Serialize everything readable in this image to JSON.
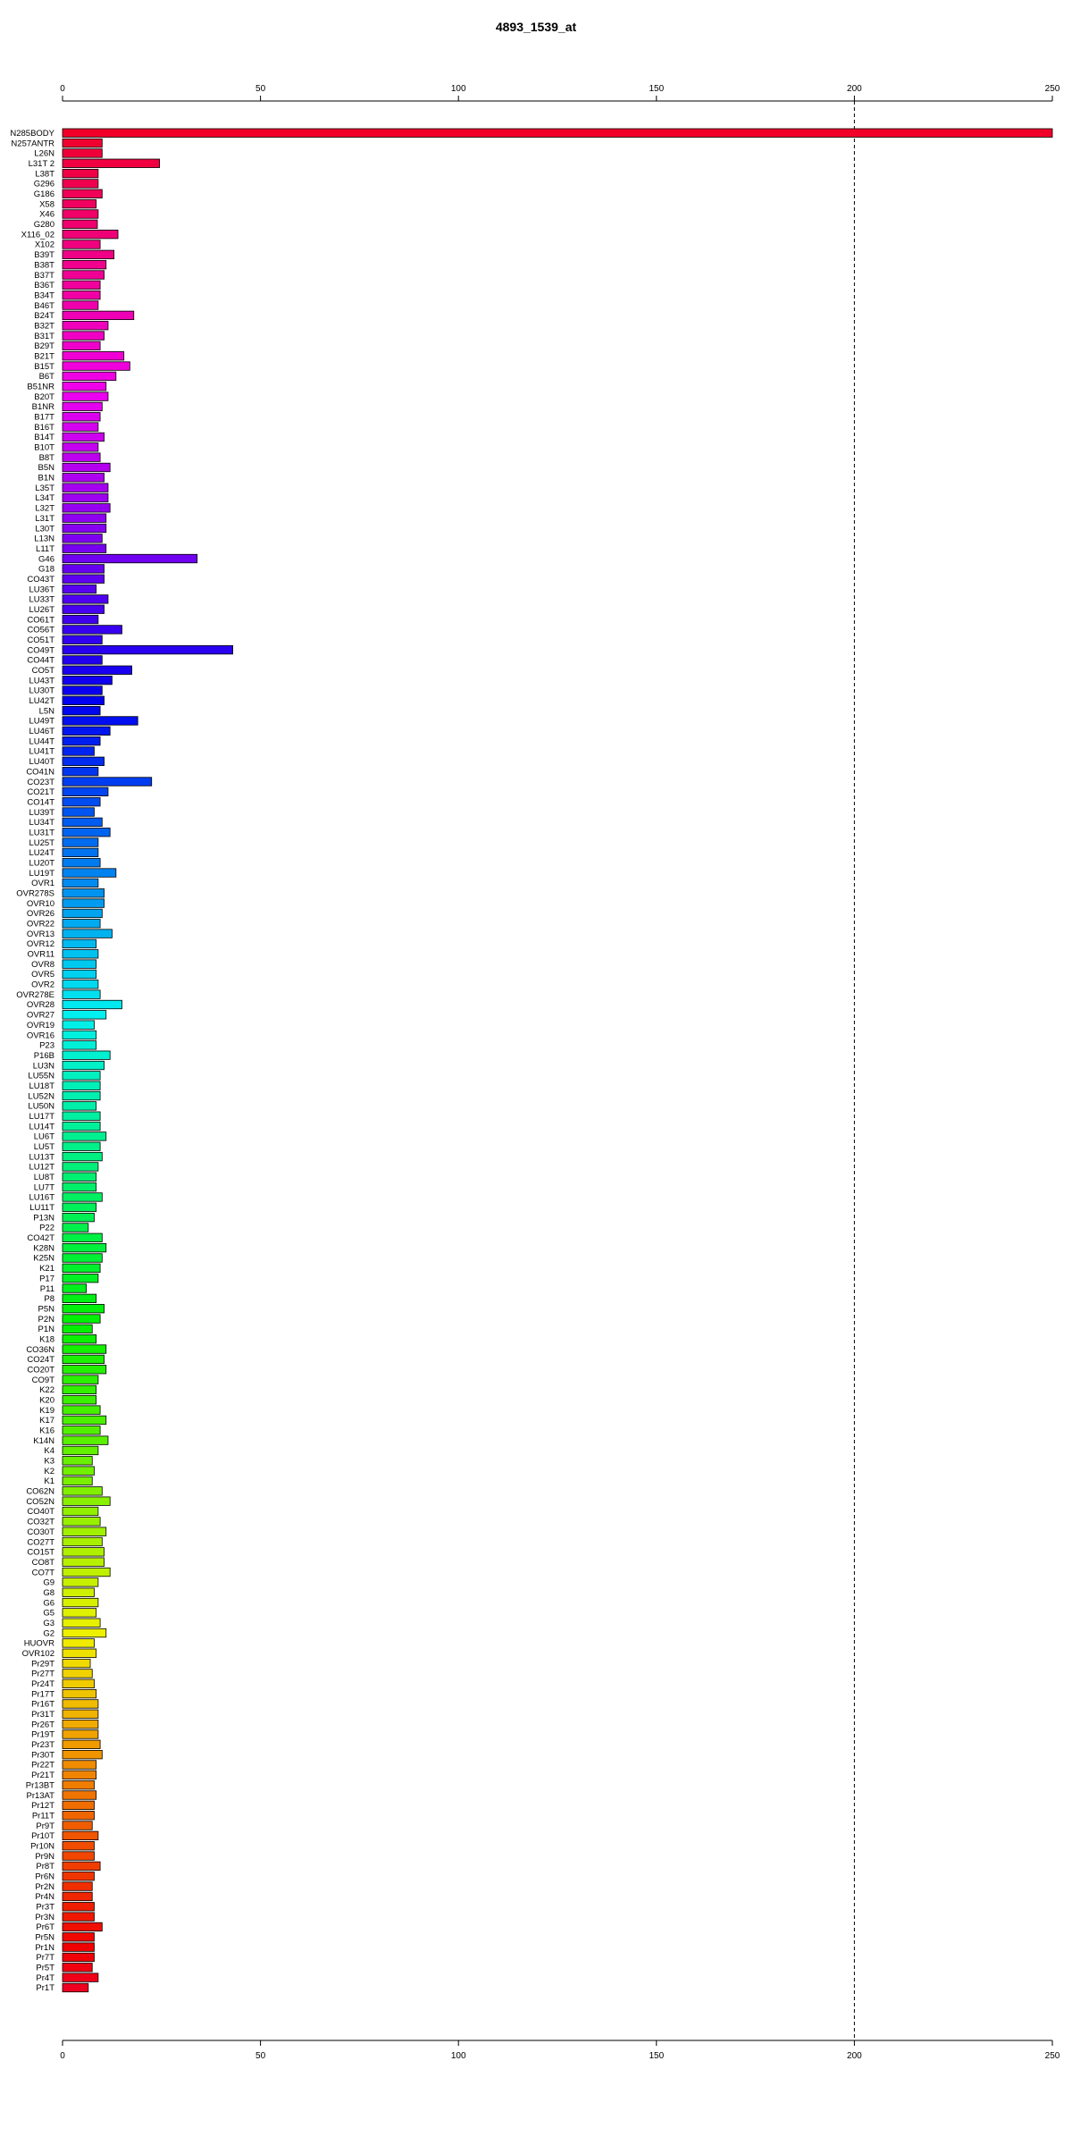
{
  "chart_data": {
    "type": "bar",
    "orientation": "horizontal",
    "title": "4893_1539_at",
    "xlabel": "",
    "ylabel": "",
    "xlim": [
      0,
      250
    ],
    "x_ticks": [
      0,
      50,
      100,
      150,
      200,
      250
    ],
    "reference_line": 200,
    "grid": false,
    "categories": [
      "N285BODY",
      "N257ANTR",
      "L26N",
      "L31T 2",
      "L38T",
      "G296",
      "G186",
      "X58",
      "X46",
      "G280",
      "X116_02",
      "X102",
      "B39T",
      "B38T",
      "B37T",
      "B36T",
      "B34T",
      "B46T",
      "B24T",
      "B32T",
      "B31T",
      "B29T",
      "B21T",
      "B15T",
      "B6T",
      "B51NR",
      "B20T",
      "B1NR",
      "B17T",
      "B16T",
      "B14T",
      "B10T",
      "B8T",
      "B5N",
      "B1N",
      "L35T",
      "L34T",
      "L32T",
      "L31T",
      "L30T",
      "L13N",
      "L11T",
      "G46",
      "G18",
      "CO43T",
      "LU36T",
      "LU33T",
      "LU26T",
      "CO61T",
      "CO56T",
      "CO51T",
      "CO49T",
      "CO44T",
      "CO5T",
      "LU43T",
      "LU30T",
      "LU42T",
      "L5N",
      "LU49T",
      "LU46T",
      "LU44T",
      "LU41T",
      "LU40T",
      "CO41N",
      "CO23T",
      "CO21T",
      "CO14T",
      "LU39T",
      "LU34T",
      "LU31T",
      "LU25T",
      "LU24T",
      "LU20T",
      "LU19T",
      "OVR1",
      "OVR278S",
      "OVR10",
      "OVR26",
      "OVR22",
      "OVR13",
      "OVR12",
      "OVR11",
      "OVR8",
      "OVR5",
      "OVR2",
      "OVR278E",
      "OVR28",
      "OVR27",
      "OVR19",
      "OVR16",
      "P23",
      "P16B",
      "LU3N",
      "LU55N",
      "LU18T",
      "LU52N",
      "LU50N",
      "LU17T",
      "LU14T",
      "LU6T",
      "LU5T",
      "LU13T",
      "LU12T",
      "LU8T",
      "LU7T",
      "LU16T",
      "LU11T",
      "P13N",
      "P22",
      "CO42T",
      "K28N",
      "K25N",
      "K21",
      "P17",
      "P11",
      "P8",
      "P5N",
      "P2N",
      "P1N",
      "K18",
      "CO36N",
      "CO24T",
      "CO20T",
      "CO9T",
      "K22",
      "K20",
      "K19",
      "K17",
      "K16",
      "K14N",
      "K4",
      "K3",
      "K2",
      "K1",
      "CO62N",
      "CO52N",
      "CO40T",
      "CO32T",
      "CO30T",
      "CO27T",
      "CO15T",
      "CO8T",
      "CO7T",
      "G9",
      "G8",
      "G6",
      "G5",
      "G3",
      "G2",
      "HUOVR",
      "OVR102",
      "Pr29T",
      "Pr27T",
      "Pr24T",
      "Pr17T",
      "Pr16T",
      "Pr31T",
      "Pr26T",
      "Pr19T",
      "Pr23T",
      "Pr30T",
      "Pr22T",
      "Pr21T",
      "Pr13BT",
      "Pr13AT",
      "Pr12T",
      "Pr11T",
      "Pr9T",
      "Pr10T",
      "Pr10N",
      "Pr9N",
      "Pr8T",
      "Pr6N",
      "Pr2N",
      "Pr4N",
      "Pr3T",
      "Pr3N",
      "Pr6T",
      "Pr5N",
      "Pr1N",
      "Pr7T",
      "Pr5T",
      "Pr4T",
      "Pr1T"
    ],
    "values": [
      253,
      10,
      10,
      24.5,
      9,
      9,
      10,
      8.5,
      9,
      8.8,
      14,
      9.5,
      13,
      11,
      10.5,
      9.5,
      9.5,
      9,
      18,
      11.5,
      10.5,
      9.5,
      15.5,
      17,
      13.5,
      11,
      11.5,
      10,
      9.5,
      9,
      10.5,
      9,
      9.5,
      12,
      10.5,
      11.5,
      11.5,
      12,
      11,
      11,
      10,
      11,
      34,
      10.5,
      10.5,
      8.5,
      11.5,
      10.5,
      9,
      15,
      10,
      43,
      10,
      17.5,
      12.5,
      10,
      10.5,
      9.5,
      19,
      12,
      9.5,
      8,
      10.5,
      9,
      22.5,
      11.5,
      9.5,
      8,
      10,
      12,
      9,
      9,
      9.5,
      13.5,
      9,
      10.5,
      10.5,
      10,
      9.5,
      12.5,
      8.5,
      9,
      8.5,
      8.5,
      9,
      9.5,
      15,
      11,
      8,
      8.5,
      8.5,
      12,
      10.5,
      9.5,
      9.5,
      9.5,
      8.5,
      9.5,
      9.5,
      11,
      9.5,
      10,
      9,
      8.5,
      8.5,
      10,
      8.5,
      8,
      6.5,
      10,
      11,
      10,
      9.5,
      9,
      6,
      8.5,
      10.5,
      9.5,
      7.5,
      8.5,
      11,
      10.5,
      11,
      9,
      8.5,
      8.5,
      9.5,
      11,
      9.5,
      11.5,
      9,
      7.5,
      8,
      7.5,
      10,
      12,
      9,
      9.5,
      11,
      10,
      10.5,
      10.5,
      12,
      9,
      8,
      9,
      8.5,
      9.5,
      11,
      8,
      8.5,
      7,
      7.5,
      8,
      8.5,
      9,
      9,
      9,
      9,
      9.5,
      10,
      8.5,
      8.5,
      8,
      8.5,
      8,
      8,
      7.5,
      9,
      8,
      8,
      9.5,
      8,
      7.5,
      7.5,
      8,
      8,
      10,
      8,
      8,
      8,
      7.5,
      9,
      6.5
    ]
  }
}
